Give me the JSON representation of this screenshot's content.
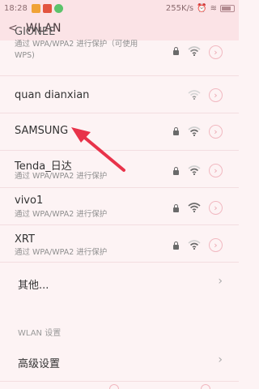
{
  "status": {
    "time": "18:28",
    "speed": "255K/s",
    "battery": ""
  },
  "header": {
    "back_icon": "chevron-left-icon",
    "title": "WLAN"
  },
  "networks": [
    {
      "name": "GIONEE",
      "sub": "通过 WPA/WPA2 进行保护（可使用",
      "sub2": "WPS)",
      "locked": true
    },
    {
      "name": "quan dianxian",
      "sub": "",
      "locked": false
    },
    {
      "name": "SAMSUNG",
      "sub": "",
      "locked": true
    },
    {
      "name": "Tenda_日达",
      "sub": "通过 WPA/WPA2 进行保护",
      "locked": true
    },
    {
      "name": "vivo1",
      "sub": "通过 WPA/WPA2 进行保护",
      "locked": true
    },
    {
      "name": "XRT",
      "sub": "通过 WPA/WPA2 进行保护",
      "locked": true
    }
  ],
  "other": {
    "label": "其他..."
  },
  "settings_section": {
    "label": "WLAN 设置"
  },
  "advanced": {
    "label": "高级设置"
  },
  "colors": {
    "accent": "#e8334a",
    "bar": "#fbe3e6",
    "bg": "#fdf3f4"
  }
}
